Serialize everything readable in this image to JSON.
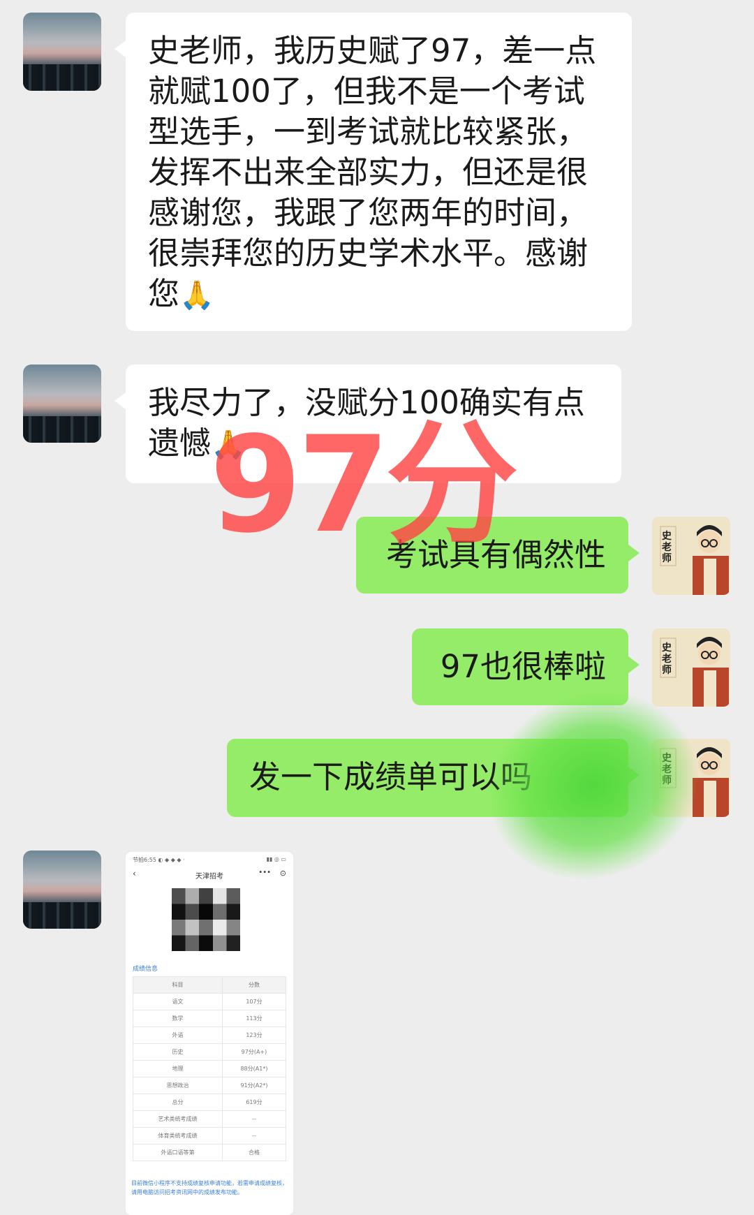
{
  "messages": [
    {
      "side": "left",
      "text": "史老师，我历史赋了97，差一点就赋100了，但我不是一个考试型选手，一到考试就比较紧张，发挥不出来全部实力，但还是很感谢您，我跟了您两年的时间，很崇拜您的历史学术水平。感谢您",
      "emoji": "🙏"
    },
    {
      "side": "left",
      "text": "我尽力了，没赋分100确实有点遗憾",
      "emoji": "🙏"
    },
    {
      "side": "right",
      "text": "考试具有偶然性"
    },
    {
      "side": "right",
      "text": "97也很棒啦"
    },
    {
      "side": "right",
      "text": "发一下成绩单可以吗"
    }
  ],
  "overlay_stamp": "97分",
  "teacher_avatar_label": "史老师",
  "score_screenshot": {
    "status_left": "节拍6:55 ◐ ◆ ◆ ◆ ·",
    "status_right": "▮▮ ◎ ▭",
    "app_title": "天津招考",
    "section_title": "成绩信息",
    "table_headers": [
      "科目",
      "分数"
    ],
    "rows": [
      [
        "语文",
        "107分"
      ],
      [
        "数学",
        "113分"
      ],
      [
        "外语",
        "123分"
      ],
      [
        "历史",
        "97分(A+)"
      ],
      [
        "地理",
        "88分(A1*)"
      ],
      [
        "思想政治",
        "91分(A2*)"
      ],
      [
        "总分",
        "619分"
      ],
      [
        "艺术类统考成绩",
        "--"
      ],
      [
        "体育类统考成绩",
        "--"
      ],
      [
        "外语口语等第",
        "合格"
      ]
    ],
    "note": "目前微信小程序不支持成绩复核申请功能，若需申请成绩复核，请用电脑访问招考资讯网中的成绩发布功能。"
  },
  "colors": {
    "background": "#ededed",
    "right_bubble": "#95ec69",
    "left_bubble": "#ffffff",
    "stamp": "#ff4646"
  }
}
